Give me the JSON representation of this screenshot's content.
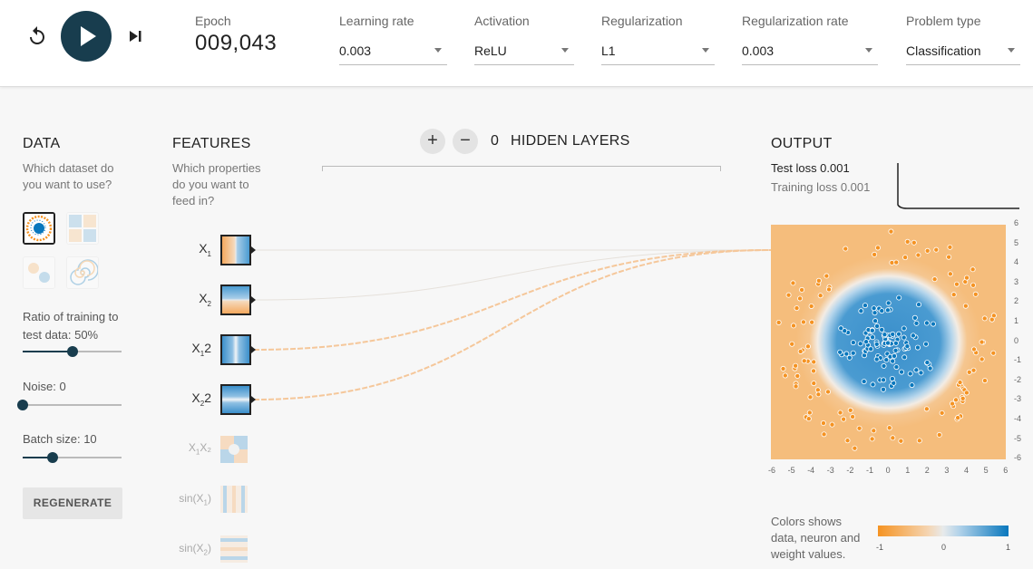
{
  "controls": {
    "epoch_label": "Epoch",
    "epoch_value": "009,043",
    "learning_rate": {
      "label": "Learning rate",
      "value": "0.003"
    },
    "activation": {
      "label": "Activation",
      "value": "ReLU"
    },
    "regularization": {
      "label": "Regularization",
      "value": "L1"
    },
    "regularization_rate": {
      "label": "Regularization rate",
      "value": "0.003"
    },
    "problem_type": {
      "label": "Problem type",
      "value": "Classification"
    }
  },
  "data_panel": {
    "title": "DATA",
    "subtitle": "Which dataset do you want to use?",
    "datasets": [
      "circle-dataset-icon",
      "xor-dataset-icon",
      "gaussian-dataset-icon",
      "spiral-dataset-icon"
    ],
    "selected_dataset": 0,
    "ratio_label": "Ratio of training to test data:  50%",
    "ratio_value": 0.5,
    "noise_label": "Noise:  0",
    "noise_value": 0,
    "batch_label": "Batch size:  10",
    "batch_value": 0.3,
    "regenerate": "REGENERATE"
  },
  "features": {
    "title": "FEATURES",
    "subtitle": "Which properties do you want to feed in?",
    "items": [
      {
        "base": "X",
        "sub": "1",
        "rest": "",
        "active": true,
        "pattern": "vertical"
      },
      {
        "base": "X",
        "sub": "2",
        "rest": "",
        "active": true,
        "pattern": "horizontal"
      },
      {
        "base": "X",
        "sub": "1",
        "rest": "2",
        "active": true,
        "pattern": "vertical-band"
      },
      {
        "base": "X",
        "sub": "2",
        "rest": "2",
        "active": true,
        "pattern": "horizontal-band"
      },
      {
        "base": "X",
        "sub": "1",
        "rest": "X₂",
        "active": false,
        "pattern": "checker"
      },
      {
        "base": "sin(X",
        "sub": "1",
        "rest": ")",
        "active": false,
        "pattern": "vertical-stripes"
      },
      {
        "base": "sin(X",
        "sub": "2",
        "rest": ")",
        "active": false,
        "pattern": "horizontal-stripes"
      }
    ]
  },
  "network": {
    "add_layer": "+",
    "remove_layer": "−",
    "hidden_layers_count": "0",
    "hidden_layers_label": "HIDDEN LAYERS"
  },
  "output": {
    "title": "OUTPUT",
    "test_loss": "Test loss 0.001",
    "training_loss": "Training loss 0.001",
    "x_ticks": [
      "-6",
      "-5",
      "-4",
      "-3",
      "-2",
      "-1",
      "0",
      "1",
      "2",
      "3",
      "4",
      "5",
      "6"
    ],
    "y_ticks": [
      "6",
      "5",
      "4",
      "3",
      "2",
      "1",
      "0",
      "-1",
      "-2",
      "-3",
      "-4",
      "-5",
      "-6"
    ],
    "legend_text": "Colors shows data, neuron and weight values.",
    "colorbar_ticks": [
      "-1",
      "0",
      "1"
    ],
    "colors": {
      "negative": "#f59322",
      "positive": "#0877bd"
    }
  }
}
